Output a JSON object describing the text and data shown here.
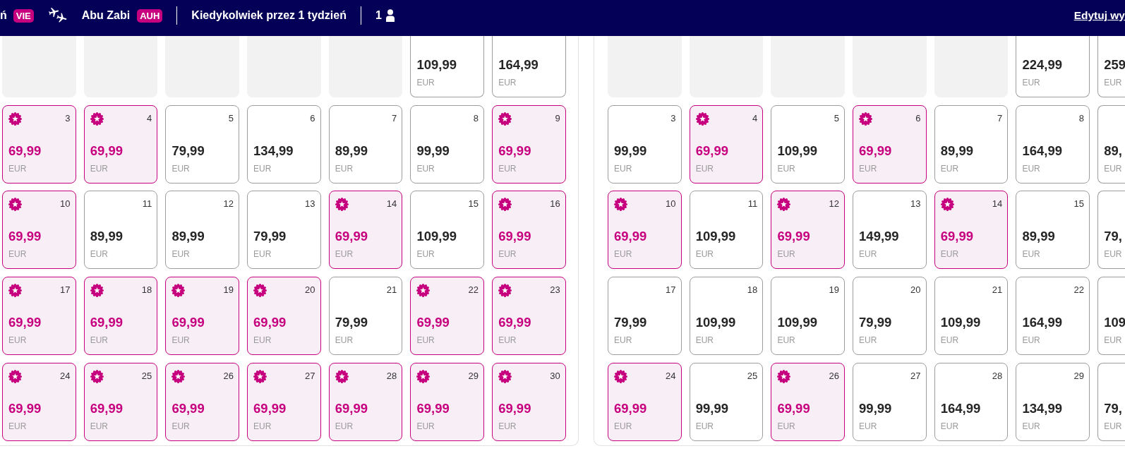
{
  "header": {
    "origin": {
      "name": "ń",
      "code": "VIE"
    },
    "destination": {
      "name": "Abu Zabi",
      "code": "AUH"
    },
    "dates": "Kiedykolwiek przez 1 tydzień",
    "passengers": "1",
    "edit_link": "Edytuj wy"
  },
  "calendars": [
    {
      "weeks": [
        [
          {
            "kind": "empty"
          },
          {
            "kind": "empty"
          },
          {
            "kind": "empty"
          },
          {
            "kind": "empty"
          },
          {
            "kind": "empty"
          },
          {
            "kind": "day",
            "price": "109,99",
            "currency": "EUR",
            "promo": false
          },
          {
            "kind": "day",
            "price": "164,99",
            "currency": "EUR",
            "promo": false
          }
        ],
        [
          {
            "kind": "day",
            "day": "3",
            "price": "69,99",
            "currency": "EUR",
            "promo": true
          },
          {
            "kind": "day",
            "day": "4",
            "price": "69,99",
            "currency": "EUR",
            "promo": true
          },
          {
            "kind": "day",
            "day": "5",
            "price": "79,99",
            "currency": "EUR",
            "promo": false
          },
          {
            "kind": "day",
            "day": "6",
            "price": "134,99",
            "currency": "EUR",
            "promo": false
          },
          {
            "kind": "day",
            "day": "7",
            "price": "89,99",
            "currency": "EUR",
            "promo": false
          },
          {
            "kind": "day",
            "day": "8",
            "price": "99,99",
            "currency": "EUR",
            "promo": false
          },
          {
            "kind": "day",
            "day": "9",
            "price": "69,99",
            "currency": "EUR",
            "promo": true
          }
        ],
        [
          {
            "kind": "day",
            "day": "10",
            "price": "69,99",
            "currency": "EUR",
            "promo": true
          },
          {
            "kind": "day",
            "day": "11",
            "price": "89,99",
            "currency": "EUR",
            "promo": false
          },
          {
            "kind": "day",
            "day": "12",
            "price": "89,99",
            "currency": "EUR",
            "promo": false
          },
          {
            "kind": "day",
            "day": "13",
            "price": "79,99",
            "currency": "EUR",
            "promo": false
          },
          {
            "kind": "day",
            "day": "14",
            "price": "69,99",
            "currency": "EUR",
            "promo": true
          },
          {
            "kind": "day",
            "day": "15",
            "price": "109,99",
            "currency": "EUR",
            "promo": false
          },
          {
            "kind": "day",
            "day": "16",
            "price": "69,99",
            "currency": "EUR",
            "promo": true
          }
        ],
        [
          {
            "kind": "day",
            "day": "17",
            "price": "69,99",
            "currency": "EUR",
            "promo": true
          },
          {
            "kind": "day",
            "day": "18",
            "price": "69,99",
            "currency": "EUR",
            "promo": true
          },
          {
            "kind": "day",
            "day": "19",
            "price": "69,99",
            "currency": "EUR",
            "promo": true
          },
          {
            "kind": "day",
            "day": "20",
            "price": "69,99",
            "currency": "EUR",
            "promo": true
          },
          {
            "kind": "day",
            "day": "21",
            "price": "79,99",
            "currency": "EUR",
            "promo": false
          },
          {
            "kind": "day",
            "day": "22",
            "price": "69,99",
            "currency": "EUR",
            "promo": true
          },
          {
            "kind": "day",
            "day": "23",
            "price": "69,99",
            "currency": "EUR",
            "promo": true
          }
        ],
        [
          {
            "kind": "day",
            "day": "24",
            "price": "69,99",
            "currency": "EUR",
            "promo": true
          },
          {
            "kind": "day",
            "day": "25",
            "price": "69,99",
            "currency": "EUR",
            "promo": true
          },
          {
            "kind": "day",
            "day": "26",
            "price": "69,99",
            "currency": "EUR",
            "promo": true
          },
          {
            "kind": "day",
            "day": "27",
            "price": "69,99",
            "currency": "EUR",
            "promo": true
          },
          {
            "kind": "day",
            "day": "28",
            "price": "69,99",
            "currency": "EUR",
            "promo": true
          },
          {
            "kind": "day",
            "day": "29",
            "price": "69,99",
            "currency": "EUR",
            "promo": true
          },
          {
            "kind": "day",
            "day": "30",
            "price": "69,99",
            "currency": "EUR",
            "promo": true
          }
        ]
      ]
    },
    {
      "weeks": [
        [
          {
            "kind": "empty"
          },
          {
            "kind": "empty"
          },
          {
            "kind": "empty"
          },
          {
            "kind": "empty"
          },
          {
            "kind": "empty"
          },
          {
            "kind": "day",
            "price": "224,99",
            "currency": "EUR",
            "promo": false
          },
          {
            "kind": "day",
            "price": "259",
            "currency": "EUR",
            "promo": false
          }
        ],
        [
          {
            "kind": "day",
            "day": "3",
            "price": "99,99",
            "currency": "EUR",
            "promo": false
          },
          {
            "kind": "day",
            "day": "4",
            "price": "69,99",
            "currency": "EUR",
            "promo": true
          },
          {
            "kind": "day",
            "day": "5",
            "price": "109,99",
            "currency": "EUR",
            "promo": false
          },
          {
            "kind": "day",
            "day": "6",
            "price": "69,99",
            "currency": "EUR",
            "promo": true
          },
          {
            "kind": "day",
            "day": "7",
            "price": "89,99",
            "currency": "EUR",
            "promo": false
          },
          {
            "kind": "day",
            "day": "8",
            "price": "164,99",
            "currency": "EUR",
            "promo": false
          },
          {
            "kind": "day",
            "price": "89,",
            "currency": "EUR",
            "promo": false
          }
        ],
        [
          {
            "kind": "day",
            "day": "10",
            "price": "69,99",
            "currency": "EUR",
            "promo": true
          },
          {
            "kind": "day",
            "day": "11",
            "price": "109,99",
            "currency": "EUR",
            "promo": false
          },
          {
            "kind": "day",
            "day": "12",
            "price": "69,99",
            "currency": "EUR",
            "promo": true
          },
          {
            "kind": "day",
            "day": "13",
            "price": "149,99",
            "currency": "EUR",
            "promo": false
          },
          {
            "kind": "day",
            "day": "14",
            "price": "69,99",
            "currency": "EUR",
            "promo": true
          },
          {
            "kind": "day",
            "day": "15",
            "price": "89,99",
            "currency": "EUR",
            "promo": false
          },
          {
            "kind": "day",
            "price": "79,",
            "currency": "EUR",
            "promo": false
          }
        ],
        [
          {
            "kind": "day",
            "day": "17",
            "price": "79,99",
            "currency": "EUR",
            "promo": false
          },
          {
            "kind": "day",
            "day": "18",
            "price": "109,99",
            "currency": "EUR",
            "promo": false
          },
          {
            "kind": "day",
            "day": "19",
            "price": "109,99",
            "currency": "EUR",
            "promo": false
          },
          {
            "kind": "day",
            "day": "20",
            "price": "79,99",
            "currency": "EUR",
            "promo": false
          },
          {
            "kind": "day",
            "day": "21",
            "price": "109,99",
            "currency": "EUR",
            "promo": false
          },
          {
            "kind": "day",
            "day": "22",
            "price": "164,99",
            "currency": "EUR",
            "promo": false
          },
          {
            "kind": "day",
            "price": "109",
            "currency": "EUR",
            "promo": false
          }
        ],
        [
          {
            "kind": "day",
            "day": "24",
            "price": "69,99",
            "currency": "EUR",
            "promo": true
          },
          {
            "kind": "day",
            "day": "25",
            "price": "99,99",
            "currency": "EUR",
            "promo": false
          },
          {
            "kind": "day",
            "day": "26",
            "price": "69,99",
            "currency": "EUR",
            "promo": true
          },
          {
            "kind": "day",
            "day": "27",
            "price": "99,99",
            "currency": "EUR",
            "promo": false
          },
          {
            "kind": "day",
            "day": "28",
            "price": "164,99",
            "currency": "EUR",
            "promo": false
          },
          {
            "kind": "day",
            "day": "29",
            "price": "134,99",
            "currency": "EUR",
            "promo": false
          },
          {
            "kind": "day",
            "price": "79,",
            "currency": "EUR",
            "promo": false
          }
        ]
      ]
    }
  ]
}
